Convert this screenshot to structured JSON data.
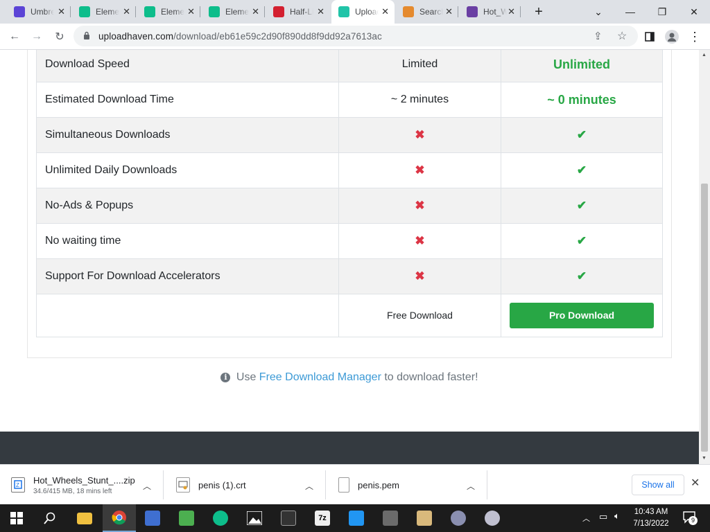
{
  "browser": {
    "tabs": [
      {
        "title": "Umbrel",
        "favicon": "umbrel-icon",
        "color": "#5b44d6"
      },
      {
        "title": "Element",
        "favicon": "element-icon",
        "color": "#0dbd8b"
      },
      {
        "title": "Element",
        "favicon": "element-icon",
        "color": "#0dbd8b"
      },
      {
        "title": "Element",
        "favicon": "element-icon",
        "color": "#0dbd8b"
      },
      {
        "title": "Half-Life",
        "favicon": "lock-icon",
        "color": "#d32030"
      },
      {
        "title": "UploadHaven",
        "favicon": "uploadhaven-icon",
        "color": "#21c4a8",
        "active": true
      },
      {
        "title": "Search",
        "favicon": "person-icon",
        "color": "#e58a2e"
      },
      {
        "title": "Hot_Wheels",
        "favicon": "globe-icon",
        "color": "#6a3fa3"
      }
    ],
    "url_host": "uploadhaven.com",
    "url_path": "/download/eb61e59c2d90f890dd8f9dd92a7613ac"
  },
  "comparison": {
    "rows": [
      {
        "feature": "Download Speed",
        "free": "Limited",
        "pro": "Unlimited",
        "kind": "text"
      },
      {
        "feature": "Estimated Download Time",
        "free": "~ 2 minutes",
        "pro": "~ 0 minutes",
        "kind": "text"
      },
      {
        "feature": "Simultaneous Downloads",
        "free": "✖",
        "pro": "✔",
        "kind": "mark"
      },
      {
        "feature": "Unlimited Daily Downloads",
        "free": "✖",
        "pro": "✔",
        "kind": "mark"
      },
      {
        "feature": "No-Ads & Popups",
        "free": "✖",
        "pro": "✔",
        "kind": "mark"
      },
      {
        "feature": "No waiting time",
        "free": "✖",
        "pro": "✔",
        "kind": "mark"
      },
      {
        "feature": "Support For Download Accelerators",
        "free": "✖",
        "pro": "✔",
        "kind": "mark"
      }
    ],
    "free_download_label": "Free Download",
    "pro_download_label": "Pro Download"
  },
  "tip": {
    "prefix": "Use",
    "link": "Free Download Manager",
    "suffix": "to download faster!"
  },
  "downloads": {
    "items": [
      {
        "name": "Hot_Wheels_Stunt_....zip",
        "status": "34.6/415 MB, 18 mins left",
        "icon": "zip-file-icon"
      },
      {
        "name": "penis (1).crt",
        "status": "",
        "icon": "certificate-file-icon"
      },
      {
        "name": "penis.pem",
        "status": "",
        "icon": "file-icon"
      }
    ],
    "show_all": "Show all"
  },
  "taskbar": {
    "time": "10:43 AM",
    "date": "7/13/2022",
    "notifications": "9"
  },
  "colors": {
    "accent_green": "#28a745",
    "cross_red": "#dc3545",
    "link_blue": "#3c9ad6",
    "footer": "#343a40"
  }
}
